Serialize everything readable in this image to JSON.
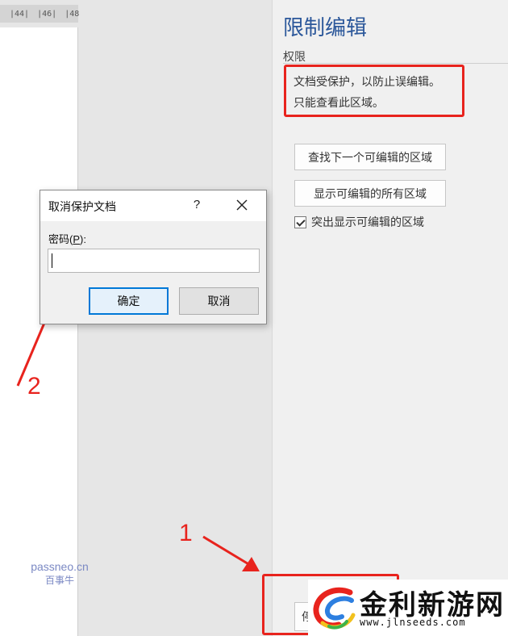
{
  "ruler": {
    "ticks": [
      "|44|",
      "|46|",
      "|48"
    ]
  },
  "watermark": {
    "line1": "passneo.cn",
    "line2": "百事牛"
  },
  "pane": {
    "title": "限制编辑",
    "section_label": "权限",
    "protection_message_line1": "文档受保护，以防止误编辑。",
    "protection_message_line2": "只能查看此区域。",
    "find_next_button": "查找下一个可编辑的区域",
    "show_all_button": "显示可编辑的所有区域",
    "highlight_checkbox_label": "突出显示可编辑的区域",
    "highlight_checked": true,
    "stop_protection_button_partial": "停"
  },
  "dialog": {
    "title": "取消保护文档",
    "help": "?",
    "password_label_prefix": "密码(",
    "password_label_accel": "P",
    "password_label_suffix": "):",
    "password_value": "",
    "ok_button": "确定",
    "cancel_button": "取消"
  },
  "annotations": {
    "label_1": "1",
    "label_2": "2",
    "color": "#e8231d"
  },
  "logo": {
    "name": "金利新游网",
    "url": "www.jlnseeds.com"
  }
}
